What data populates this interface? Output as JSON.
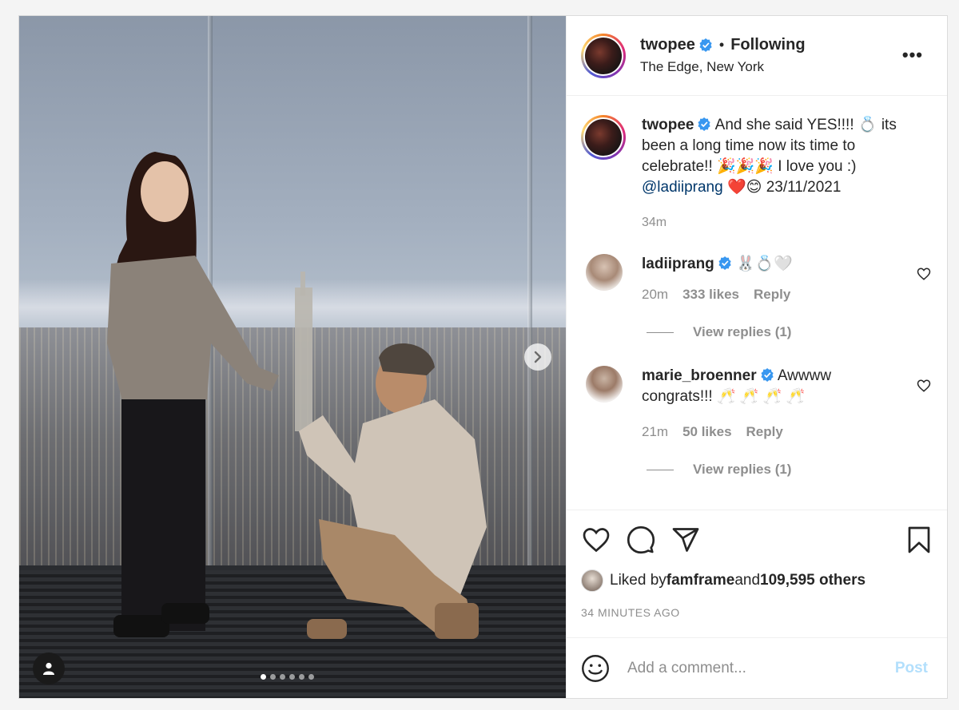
{
  "post": {
    "author": "twopee",
    "follow_state": "Following",
    "location": "The Edge, New York",
    "more_label": "•••",
    "carousel": {
      "slides": 6,
      "active_index": 0
    }
  },
  "caption": {
    "username": "twopee",
    "text": " And she said YES!!!! 💍 its been a long time now its time to celebrate!! 🎉🎉🎉 I love you :) ",
    "mention": "@ladiiprang",
    "text_after": " ❤️😊 23/11/2021",
    "time": "34m"
  },
  "comments": [
    {
      "username": "ladiiprang",
      "text": " 🐰💍🤍",
      "time": "20m",
      "likes": "333 likes",
      "reply_label": "Reply",
      "view_replies": "View replies (1)"
    },
    {
      "username": "marie_broenner",
      "text": " Awwww congrats!!! 🥂 🥂 🥂 🥂",
      "time": "21m",
      "likes": "50 likes",
      "reply_label": "Reply",
      "view_replies": "View replies (1)"
    }
  ],
  "likes": {
    "prefix": "Liked by ",
    "first_liker": "famframe",
    "middle": " and ",
    "others": "109,595 others"
  },
  "timestamp": "34 MINUTES AGO",
  "add_comment": {
    "placeholder": "Add a comment...",
    "post_label": "Post"
  },
  "colors": {
    "verified": "#3897f0",
    "link": "#00376b",
    "muted": "#8e8e8e",
    "post_disabled": "#b2dffc"
  },
  "icons": [
    "heart-icon",
    "comment-icon",
    "share-icon",
    "bookmark-icon",
    "emoji-icon",
    "user-tag-icon",
    "chevron-right-icon",
    "verified-badge-icon"
  ]
}
